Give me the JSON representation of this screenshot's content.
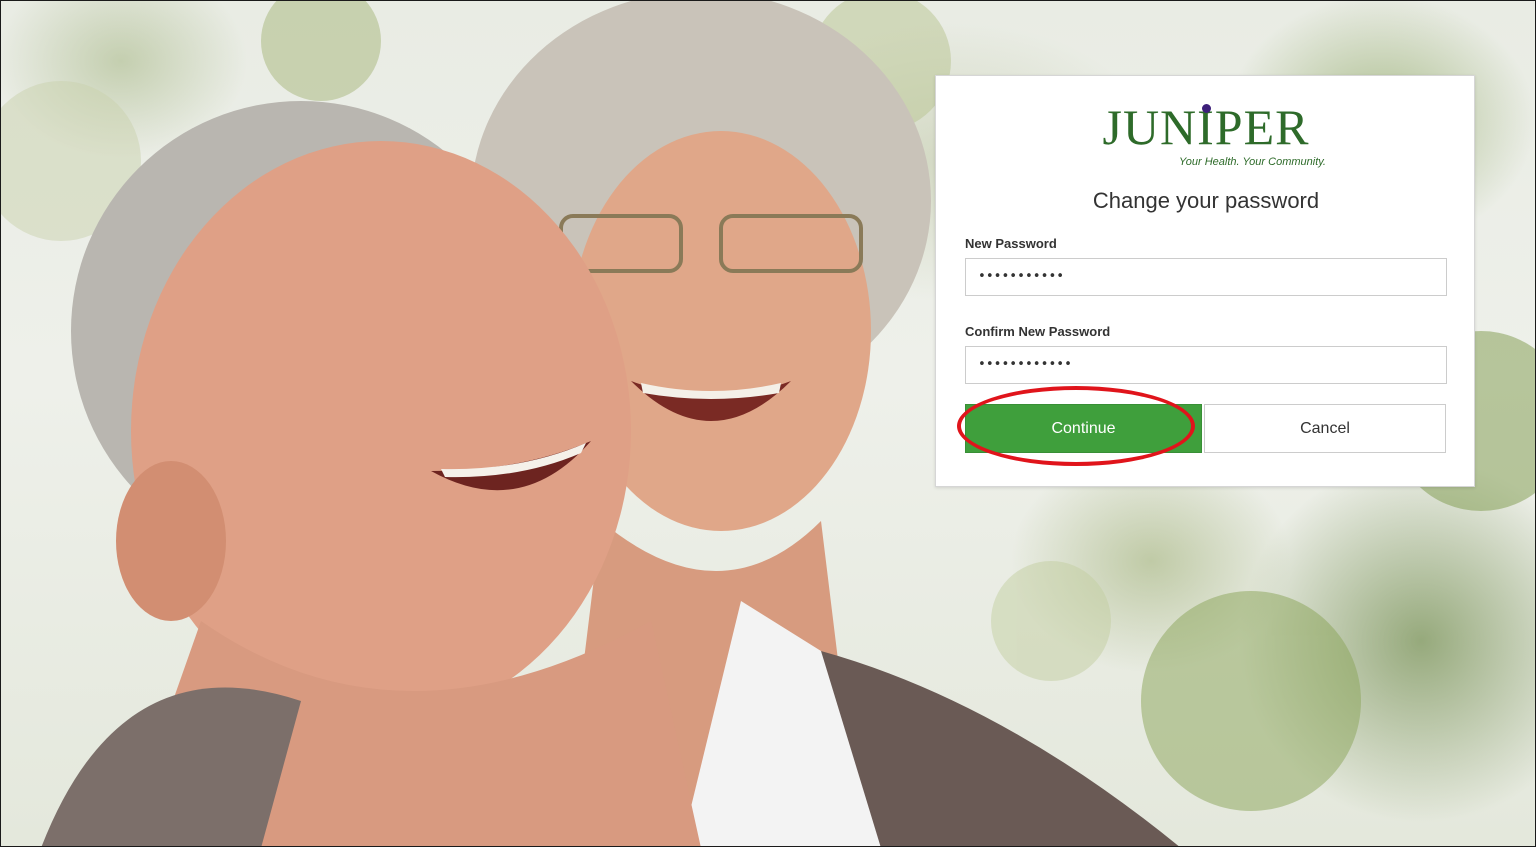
{
  "background": {
    "description_icon": "couple-photo"
  },
  "card": {
    "logo": {
      "wordmark": "JUNIPER",
      "tagline": "Your Health. Your Community.",
      "brand_color": "#2e6b2a",
      "dot_color": "#3d1f7a"
    },
    "title": "Change your password",
    "new_password": {
      "label": "New Password",
      "value": "•••••••••••"
    },
    "confirm_password": {
      "label": "Confirm New Password",
      "value": "••••••••••••"
    },
    "continue_label": "Continue",
    "cancel_label": "Cancel",
    "accent_color": "#3f9f3c"
  },
  "annotation": {
    "color": "#e0141b",
    "shape": "ellipse"
  }
}
